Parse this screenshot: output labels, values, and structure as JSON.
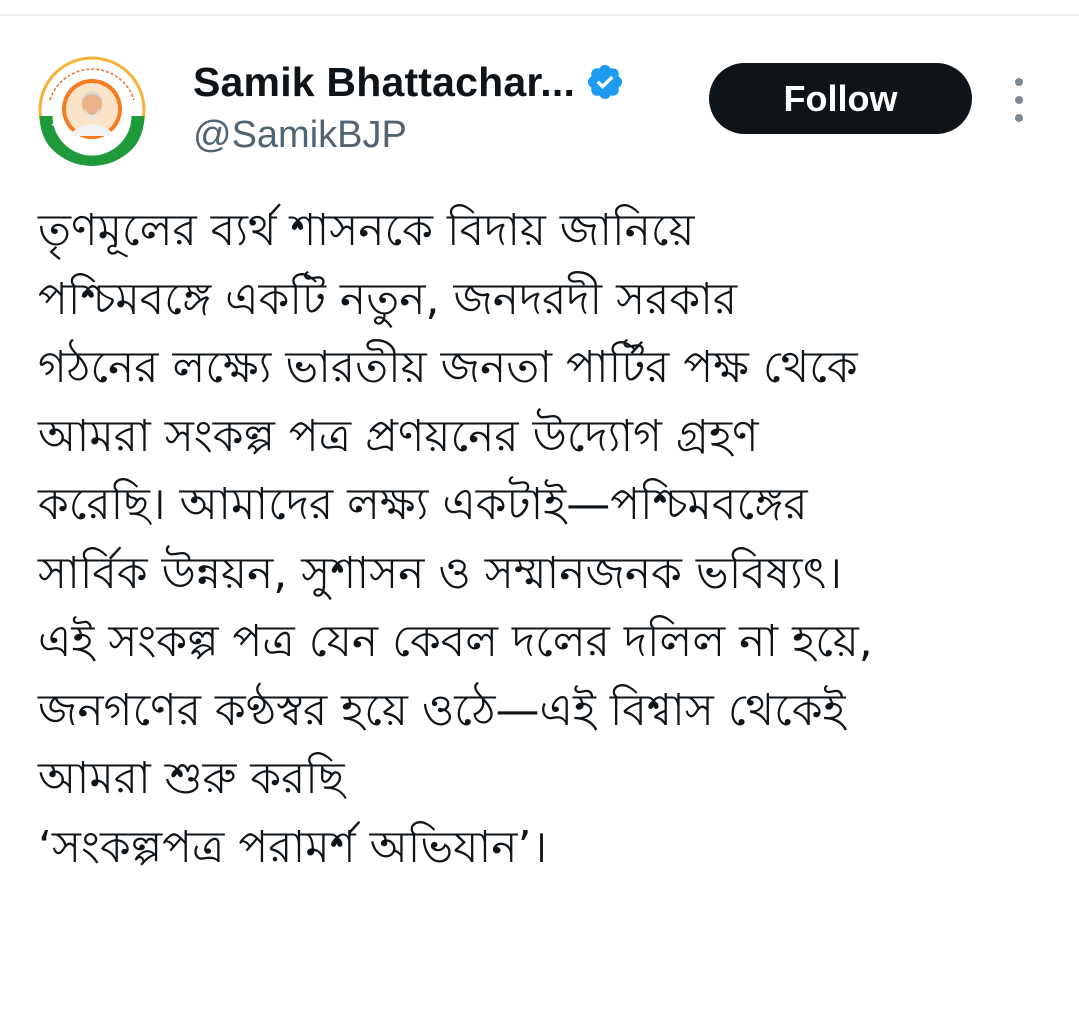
{
  "author": {
    "display_name": "Samik Bhattachar...",
    "handle": "@SamikBJP",
    "verified": true,
    "avatar_icon": "profile-photo-icon",
    "avatar_colors": {
      "ring_outer": "#1f9a3a",
      "ring_inner": "#f47b20",
      "background": "#ffffff"
    }
  },
  "actions": {
    "follow_label": "Follow",
    "more_icon": "more-vertical-icon"
  },
  "tweet": {
    "lines": [
      "তৃণমূলের ব্যর্থ শাসনকে বিদায় জানিয়ে",
      "পশ্চিমবঙ্গে একটি নতুন, জনদরদী সরকার",
      "গঠনের লক্ষ্যে ভারতীয় জনতা পার্টির পক্ষ থেকে",
      "আমরা সংকল্প পত্র প্রণয়নের উদ্যোগ গ্রহণ",
      "করেছি। আমাদের লক্ষ্য একটাই—পশ্চিমবঙ্গের",
      "সার্বিক উন্নয়ন, সুশাসন ও সম্মানজনক ভবিষ্যৎ।",
      "এই সংকল্প পত্র যেন কেবল দলের দলিল না হয়ে,",
      "জনগণের কণ্ঠস্বর হয়ে ওঠে—এই বিশ্বাস থেকেই",
      "আমরা শুরু করছি",
      "‘সংকল্পপত্র পরামর্শ অভিযান’।"
    ]
  },
  "colors": {
    "text_primary": "#0f1419",
    "text_secondary": "#536471",
    "verified_blue": "#1d9bf0",
    "follow_bg": "#0f1419",
    "follow_text": "#ffffff"
  }
}
